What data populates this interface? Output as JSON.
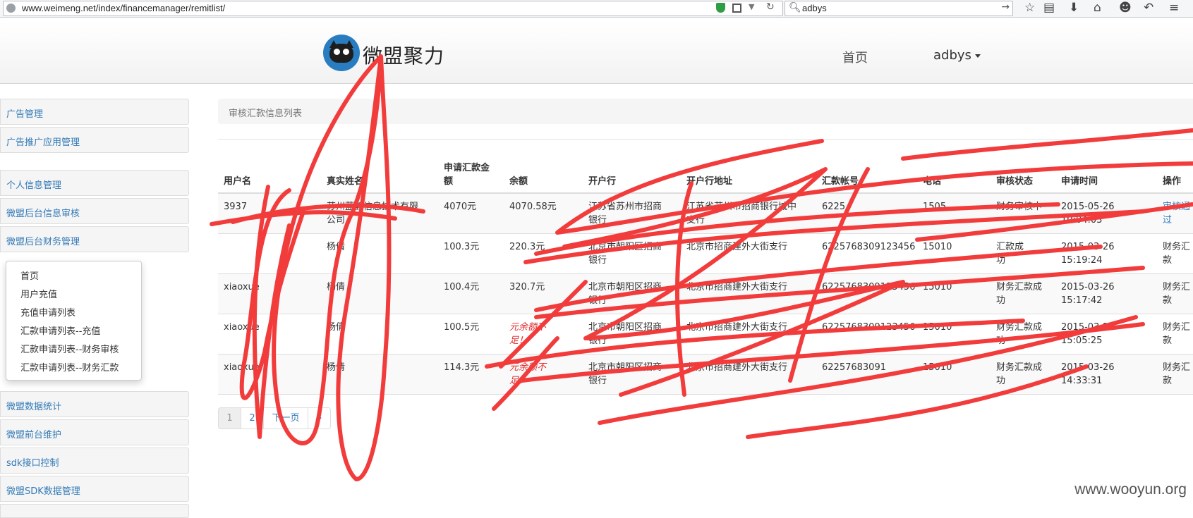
{
  "browser": {
    "url": "www.weimeng.net/index/financemanager/remitlist/",
    "search": "adbys",
    "icons": [
      "site-icon",
      "shield-icon",
      "qr-icon",
      "dropdown-icon",
      "refresh-icon",
      "search-icon",
      "go-arrow-icon",
      "star-icon",
      "reader-icon",
      "download-icon",
      "home-icon",
      "chat-icon",
      "back-icon",
      "menu-icon"
    ]
  },
  "header": {
    "logo_text": "微盟聚力",
    "nav_home": "首页",
    "nav_user": "adbys"
  },
  "sidebar": {
    "items": [
      "广告管理",
      "广告推广应用管理",
      "个人信息管理",
      "微盟后台信息审核",
      "微盟后台财务管理",
      "微盟数据统计",
      "微盟前台维护",
      "sdk接口控制",
      "微盟SDK数据管理"
    ],
    "submenu": [
      "首页",
      "用户充值",
      "充值申请列表",
      "汇款申请列表--充值",
      "汇款申请列表--财务审核",
      "汇款申请列表--财务汇款"
    ]
  },
  "main": {
    "breadcrumb": "审核汇款信息列表",
    "columns": [
      "用户名",
      "真实姓名",
      "申请汇款金\n额",
      "余额",
      "开户行",
      "开户行地址",
      "汇款帐号",
      "电话",
      "审核状态",
      "申请时间",
      "操作"
    ],
    "rows": [
      {
        "user": "3937",
        "real": "苏州蓝鹤信息技术有限\n公司",
        "amount": "4070元",
        "balance": "4070.58元",
        "bank": "江苏省苏州市招商\n银行",
        "bank_addr": "江苏省苏州市招商银行城中\n支行",
        "account": "6225",
        "phone": "1505",
        "status": "财务审核中",
        "time": "2015-05-26\n10:04:03",
        "op": "审核通过"
      },
      {
        "user": "",
        "real": "杨倩",
        "amount": "100.3元",
        "balance": "220.3元",
        "bank": "北京市朝阳区招商\n银行",
        "bank_addr": "北京市招商建外大街支行",
        "account": "6225768309123456",
        "phone": "15010",
        "status": "汇款成\n功",
        "time": "2015-03-26\n15:19:24",
        "op": "财务汇款"
      },
      {
        "user": "xiaoxue",
        "real": "杨倩",
        "amount": "100.4元",
        "balance": "320.7元",
        "bank": "北京市朝阳区招商\n银行",
        "bank_addr": "北京市招商建外大街支行",
        "account": "6225768309123456",
        "phone": "15010",
        "status": "财务汇款成\n功",
        "time": "2015-03-26\n15:17:42",
        "op": "财务汇款"
      },
      {
        "user": "xiaoxue",
        "real": "杨倩",
        "amount": "100.5元",
        "balance": "元余额不\n足！",
        "bank": "北京市朝阳区招商\n银行",
        "bank_addr": "北京市招商建外大街支行",
        "account": "6225768309123456",
        "phone": "15010",
        "status": "财务汇款成\n功",
        "time": "2015-03-26\n15:05:25",
        "op": "财务汇款"
      },
      {
        "user": "xiaoxue",
        "real": "杨倩",
        "amount": "114.3元",
        "balance": "元余额不\n足！",
        "bank": "北京市朝阳区招商\n银行",
        "bank_addr": "北京市招商建外大街支行",
        "account": "62257683091",
        "phone": "15010",
        "status": "财务汇款成\n功",
        "time": "2015-03-26\n14:33:31",
        "op": "财务汇款"
      }
    ],
    "pager": [
      "1",
      "2",
      "下一页",
      "»"
    ]
  },
  "colors": {
    "link": "#337ab7",
    "scribble": "#f23c3c",
    "warning_text": "#e02b2b"
  },
  "watermark": "www.wooyun.org"
}
